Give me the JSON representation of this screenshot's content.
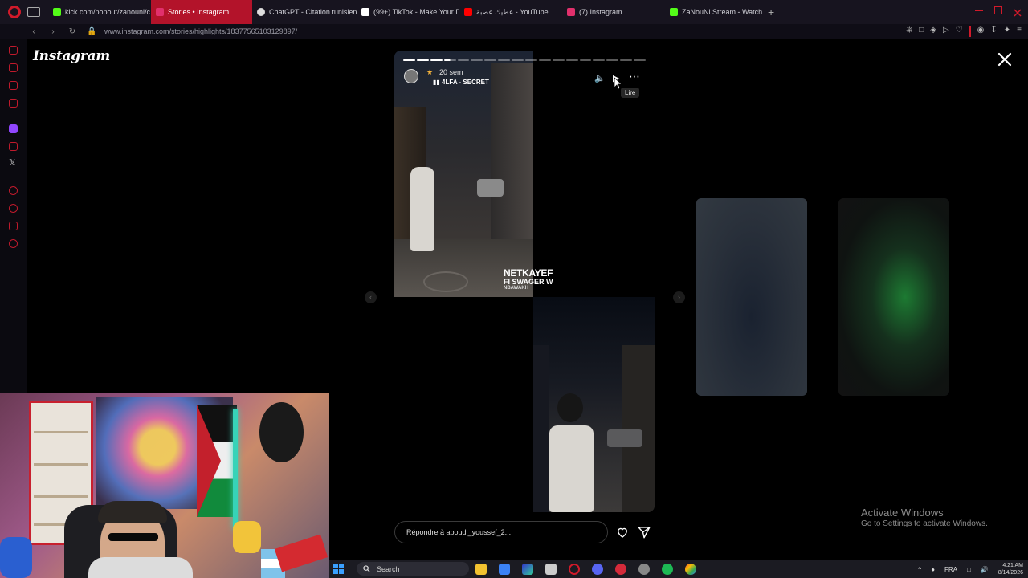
{
  "browser": {
    "tabs": [
      {
        "label": "kick.com/popout/zanouni/c",
        "color": "#53fc18",
        "active": false
      },
      {
        "label": "Stories • Instagram",
        "color": "#e1306c",
        "active": true
      },
      {
        "label": "ChatGPT - Citation tunisien",
        "color": "#dddddd",
        "active": false
      },
      {
        "label": "(99+) TikTok - Make Your D",
        "color": "#ffffff",
        "active": false
      },
      {
        "label": "عطيك عصبة - YouTube",
        "color": "#ff0000",
        "active": false
      },
      {
        "label": "(7) Instagram",
        "color": "#e1306c",
        "active": false
      },
      {
        "label": "ZaNouNi Stream - Watch L",
        "color": "#53fc18",
        "active": false
      }
    ],
    "url": "www.instagram.com/stories/highlights/18377565103129897/",
    "new_tab": "+"
  },
  "instagram": {
    "logo": "Instagram",
    "story": {
      "time": "20 sem",
      "music": "4LFA - SECRET",
      "caption_line1": "NETKAYEF",
      "caption_line2": "FI SWAGER W",
      "caption_line3": "NBAWAKH",
      "tooltip": "Lire",
      "progress_total": 18,
      "progress_done": 3
    },
    "reply_placeholder": "Répondre à aboudi_youssef_2..."
  },
  "windows_watermark": {
    "line1": "Activate Windows",
    "line2": "Go to Settings to activate Windows."
  },
  "taskbar": {
    "search_label": "Search",
    "language": "FRA",
    "time": "4:21 AM",
    "date": "8/14/2026",
    "chevron": "^"
  }
}
